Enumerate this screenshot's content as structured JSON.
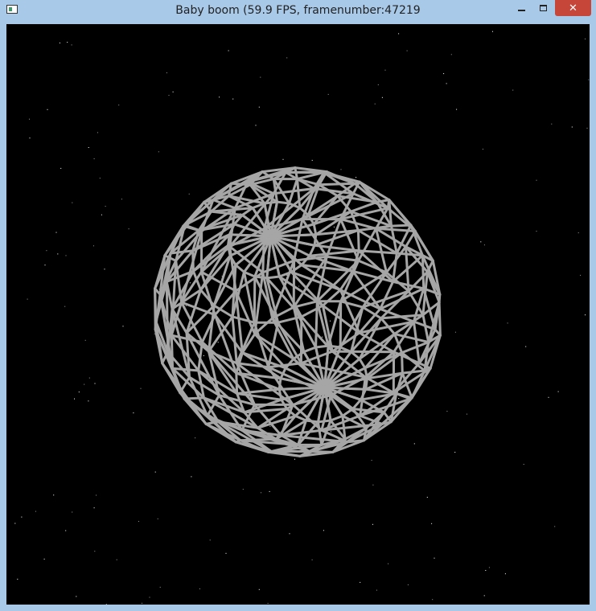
{
  "window": {
    "title": "Baby boom (59.9 FPS, framenumber:47219"
  },
  "controls": {
    "minimize_icon": "minimize-icon",
    "maximize_icon": "maximize-icon",
    "close_icon": "close-icon",
    "close_glyph": "✕"
  },
  "colors": {
    "titlebar": "#a9c9e9",
    "close_button": "#c7463a",
    "background": "#000000",
    "wireframe": "#a6a6a6",
    "stars": "#ffffff"
  }
}
